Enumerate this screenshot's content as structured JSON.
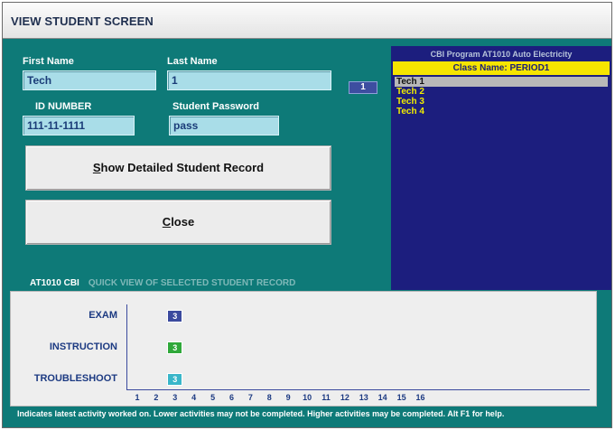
{
  "window": {
    "title": "VIEW STUDENT SCREEN"
  },
  "form": {
    "first_name_label": "First Name",
    "first_name_value": "Tech",
    "last_name_label": "Last Name",
    "last_name_value": "1",
    "id_label": "ID NUMBER",
    "id_value": "111-11-1111",
    "password_label": "Student Password",
    "password_value": "pass"
  },
  "spinner": {
    "value": "1"
  },
  "buttons": {
    "show_detailed_underline": "S",
    "show_detailed_rest": "how Detailed Student Record",
    "close_underline": "C",
    "close_rest": "lose"
  },
  "student_list": {
    "header": "CBI Program AT1010 Auto Electricity",
    "class_name": "Class Name: PERIOD1",
    "items": [
      "Tech 1",
      "Tech 2",
      "Tech 3",
      "Tech 4"
    ],
    "selected_index": 0
  },
  "quick_view": {
    "course": "AT1010 CBI",
    "caption": "QUICK VIEW OF SELECTED STUDENT RECORD"
  },
  "chart_data": {
    "type": "table",
    "rows": [
      {
        "label": "EXAM",
        "value": 3,
        "color": "#3b4a9e"
      },
      {
        "label": "INSTRUCTION",
        "value": 3,
        "color": "#2fa83a"
      },
      {
        "label": "TROUBLESHOOT",
        "value": 3,
        "color": "#39b6c9"
      }
    ],
    "x_ticks": [
      "1",
      "2",
      "3",
      "4",
      "5",
      "6",
      "7",
      "8",
      "9",
      "10",
      "11",
      "12",
      "13",
      "14",
      "15",
      "16"
    ]
  },
  "footer": {
    "text": "Indicates latest activity worked on. Lower activities may not be completed. Higher activities may be completed. Alt F1 for help."
  },
  "colors": {
    "window_bg": "#0e7a78",
    "list_bg": "#1c1e7e",
    "class_bar": "#f6e500",
    "list_text": "#f2ec00"
  }
}
